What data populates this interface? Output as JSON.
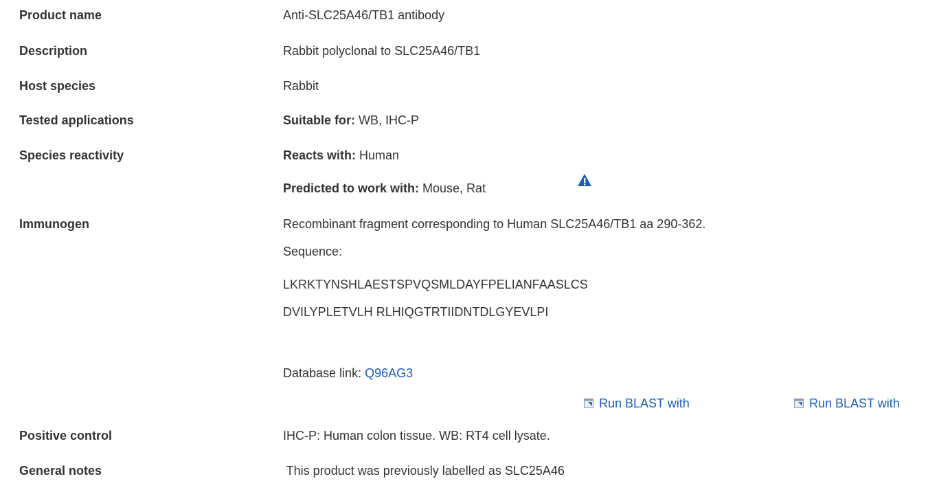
{
  "rows": {
    "product_name": {
      "label": "Product name",
      "value": "Anti-SLC25A46/TB1 antibody"
    },
    "description": {
      "label": "Description",
      "value": "Rabbit polyclonal to SLC25A46/TB1"
    },
    "host_species": {
      "label": "Host species",
      "value": "Rabbit"
    },
    "tested_applications": {
      "label": "Tested applications",
      "prefix": "Suitable for:",
      "value": " WB, IHC-P"
    },
    "species_reactivity": {
      "label": "Species reactivity",
      "reacts_prefix": "Reacts with:",
      "reacts_value": " Human",
      "predicted_prefix": "Predicted to work with:",
      "predicted_value": " Mouse, Rat"
    },
    "immunogen": {
      "label": "Immunogen",
      "line1": "Recombinant fragment corresponding to Human SLC25A46/TB1 aa 290-362.",
      "line2": "Sequence:",
      "seq1": "LKRKTYNSHLAESTSPVQSMLDAYFPELIANFAASLCS",
      "seq2": "DVILYPLETVLH RLHIQGTRTIIDNTDLGYEVLPI",
      "db_prefix": "Database link: ",
      "db_link": "Q96AG3",
      "blast1": "Run BLAST with",
      "blast2": "Run BLAST with"
    },
    "positive_control": {
      "label": "Positive control",
      "value": "IHC-P: Human colon tissue. WB: RT4 cell lysate."
    },
    "general_notes": {
      "label": "General notes",
      "value": " This product was previously labelled as SLC25A46"
    }
  },
  "colors": {
    "text": "#333333",
    "link": "#1a5fb4",
    "warning": "#1a5fb4"
  },
  "icons": {
    "warning": "warning-triangle-icon",
    "external": "external-window-icon"
  }
}
